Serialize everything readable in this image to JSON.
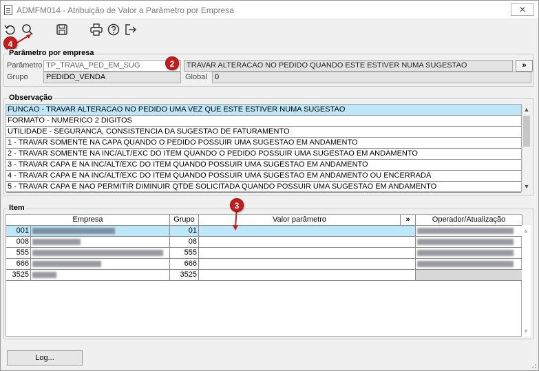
{
  "window": {
    "title": "ADMFM014 - Atribuição de Valor a Parâmetro por Empresa",
    "close_glyph": "✕"
  },
  "toolbar": {
    "buttons": [
      "refresh-icon",
      "search-icon",
      "save-icon",
      "print-icon",
      "help-icon",
      "exit-icon"
    ]
  },
  "markers": {
    "m4": "4",
    "m2": "2",
    "m3": "3"
  },
  "parametro": {
    "group_title": "Parâmetro por empresa",
    "parametro_label": "Parâmetro",
    "parametro_value": "TP_TRAVA_PED_EM_SUG",
    "descricao_value": "TRAVAR ALTERACAO NO PEDIDO QUANDO ESTE ESTIVER NUMA SUGESTAO",
    "grupo_label": "Grupo",
    "grupo_value": "PEDIDO_VENDA",
    "global_label": "Global",
    "global_value": "0",
    "more_label": "»"
  },
  "observacao": {
    "group_title": "Observação",
    "items": [
      "FUNCAO - TRAVAR ALTERACAO NO PEDIDO UMA VEZ QUE ESTE ESTIVER NUMA SUGESTAO",
      "FORMATO - NUMERICO 2 DIGITOS",
      "UTILIDADE - SEGURANCA, CONSISTENCIA DA SUGESTAO DE FATURAMENTO",
      "1 - TRAVAR SOMENTE NA CAPA QUANDO O PEDIDO POSSUIR UMA SUGESTAO EM ANDAMENTO",
      "2 - TRAVAR SOMENTE NA INC/ALT/EXC DO ITEM QUANDO O PEDIDO POSSUIR UMA SUGESTAO EM ANDAMENTO",
      "3 - TRAVAR CAPA E NA INC/ALT/EXC DO ITEM QUANDO POSSUIR UMA SUGESTAO EM ANDAMENTO",
      "4 - TRAVAR CAPA E NA INC/ALT/EXC DO ITEM QUANDO POSSUIR UMA SUGESTAO EM ANDAMENTO OU ENCERRADA",
      "5 - TRAVAR CAPA E NAO PERMITIR DIMINUIR QTDE SOLICITADA QUANDO POSSUIR UMA SUGESTAO EM ANDAMENTO"
    ]
  },
  "item": {
    "group_title": "Item",
    "headers": {
      "empresa": "Empresa",
      "grupo": "Grupo",
      "valor": "Valor parâmetro",
      "more": "»",
      "operador": "Operador/Atualização"
    },
    "rows": [
      {
        "codigo": "001",
        "grupo": "01",
        "valor": ""
      },
      {
        "codigo": "008",
        "grupo": "08",
        "valor": ""
      },
      {
        "codigo": "555",
        "grupo": "555",
        "valor": ""
      },
      {
        "codigo": "666",
        "grupo": "666",
        "valor": ""
      },
      {
        "codigo": "3525",
        "grupo": "3525",
        "valor": ""
      }
    ]
  },
  "footer": {
    "log_label": "Log..."
  }
}
